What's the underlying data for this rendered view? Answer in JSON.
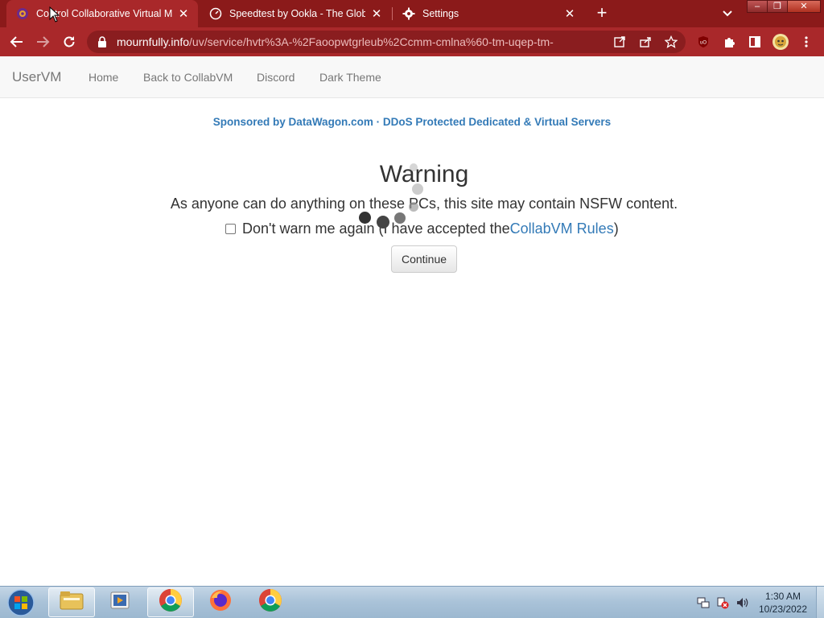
{
  "browser": {
    "tabs": [
      {
        "title": "Control Collaborative Virtual Mac",
        "active": true,
        "icon": "collabvm-favicon"
      },
      {
        "title": "Speedtest by Ookla - The Global",
        "active": false,
        "icon": "speedtest-icon"
      },
      {
        "title": "Settings",
        "active": false,
        "icon": "gear-icon"
      }
    ],
    "new_tab": "+",
    "window_controls": {
      "minimize": "–",
      "restore": "❐",
      "close": "✕"
    },
    "url_domain": "mournfully.info",
    "url_path": "/uv/service/hvtr%3A-%2Faoopwtgrleub%2Ccmm-cmlna%60-tm-uqep-tm-"
  },
  "navbar": {
    "brand": "UserVM",
    "links": [
      "Home",
      "Back to CollabVM",
      "Discord",
      "Dark Theme"
    ]
  },
  "page": {
    "sponsor_link": "Sponsored by DataWagon.com",
    "sponsor_sep": " · ",
    "sponsor_text": "DDoS Protected Dedicated & Virtual Servers",
    "warning_title": "Warning",
    "warning_text": "As anyone can do anything on these PCs, this site may contain NSFW content.",
    "checkbox_label_pre": "Don't warn me again (I have accepted the ",
    "checkbox_link": "CollabVM Rules",
    "checkbox_label_post": ")",
    "continue_label": "Continue"
  },
  "taskbar": {
    "apps": [
      "explorer-icon",
      "media-player-icon",
      "chrome-icon",
      "firefox-icon",
      "chrome-icon"
    ],
    "clock_time": "1:30 AM",
    "clock_date": "10/23/2022"
  },
  "colors": {
    "chrome_frame": "#8b1a1a",
    "chrome_toolbar": "#a9282a",
    "link": "#337ab7"
  }
}
